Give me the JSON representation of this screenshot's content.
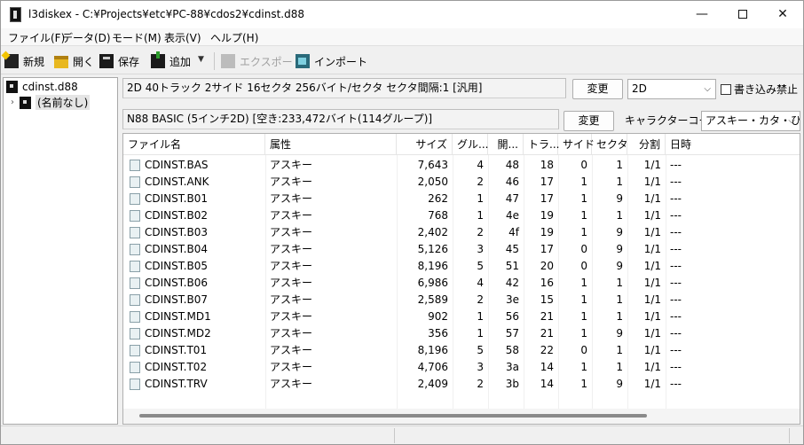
{
  "window": {
    "title": "l3diskex - C:¥Projects¥etc¥PC-88¥cdos2¥cdinst.d88",
    "minimize_glyph": "—",
    "close_glyph": "✕"
  },
  "menu": [
    "ファイル(F)",
    "データ(D)",
    "モード(M)",
    "表示(V)",
    "ヘルプ(H)"
  ],
  "toolbar": {
    "new": "新規",
    "open": "開く",
    "save": "保存",
    "add": "追加",
    "dropdown": "▼",
    "export": "エクスポート",
    "import": "インポート"
  },
  "tree": {
    "root": "cdinst.d88",
    "expander": "›",
    "child": "(名前なし)"
  },
  "disk_info": {
    "text": "2D  40トラック 2サイド 16セクタ 256バイト/セクタ セクタ間隔:1 [汎用]",
    "change_button": "変更",
    "disk_type": "2D",
    "write_protect_label": "書き込み禁止",
    "write_protect_checked": false
  },
  "file_info": {
    "text": "N88 BASIC (5インチ2D) [空き:233,472バイト(114グループ)]",
    "change_button": "変更",
    "charcode_label": "キャラクターコード",
    "charcode_value": "アスキー・カタ・ひら"
  },
  "columns": [
    "ファイル名",
    "属性",
    "サイズ",
    "グル...",
    "開...",
    "トラ...",
    "サイド",
    "セクタ",
    "分割",
    "日時"
  ],
  "files": [
    {
      "name": "CDINST.BAS",
      "attr": "アスキー",
      "size": "7,643",
      "groups": "4",
      "start": "48",
      "track": "18",
      "side": "0",
      "sector": "1",
      "split": "1/1",
      "date": "---"
    },
    {
      "name": "CDINST.ANK",
      "attr": "アスキー",
      "size": "2,050",
      "groups": "2",
      "start": "46",
      "track": "17",
      "side": "1",
      "sector": "1",
      "split": "1/1",
      "date": "---"
    },
    {
      "name": "CDINST.B01",
      "attr": "アスキー",
      "size": "262",
      "groups": "1",
      "start": "47",
      "track": "17",
      "side": "1",
      "sector": "9",
      "split": "1/1",
      "date": "---"
    },
    {
      "name": "CDINST.B02",
      "attr": "アスキー",
      "size": "768",
      "groups": "1",
      "start": "4e",
      "track": "19",
      "side": "1",
      "sector": "1",
      "split": "1/1",
      "date": "---"
    },
    {
      "name": "CDINST.B03",
      "attr": "アスキー",
      "size": "2,402",
      "groups": "2",
      "start": "4f",
      "track": "19",
      "side": "1",
      "sector": "9",
      "split": "1/1",
      "date": "---"
    },
    {
      "name": "CDINST.B04",
      "attr": "アスキー",
      "size": "5,126",
      "groups": "3",
      "start": "45",
      "track": "17",
      "side": "0",
      "sector": "9",
      "split": "1/1",
      "date": "---"
    },
    {
      "name": "CDINST.B05",
      "attr": "アスキー",
      "size": "8,196",
      "groups": "5",
      "start": "51",
      "track": "20",
      "side": "0",
      "sector": "9",
      "split": "1/1",
      "date": "---"
    },
    {
      "name": "CDINST.B06",
      "attr": "アスキー",
      "size": "6,986",
      "groups": "4",
      "start": "42",
      "track": "16",
      "side": "1",
      "sector": "1",
      "split": "1/1",
      "date": "---"
    },
    {
      "name": "CDINST.B07",
      "attr": "アスキー",
      "size": "2,589",
      "groups": "2",
      "start": "3e",
      "track": "15",
      "side": "1",
      "sector": "1",
      "split": "1/1",
      "date": "---"
    },
    {
      "name": "CDINST.MD1",
      "attr": "アスキー",
      "size": "902",
      "groups": "1",
      "start": "56",
      "track": "21",
      "side": "1",
      "sector": "1",
      "split": "1/1",
      "date": "---"
    },
    {
      "name": "CDINST.MD2",
      "attr": "アスキー",
      "size": "356",
      "groups": "1",
      "start": "57",
      "track": "21",
      "side": "1",
      "sector": "9",
      "split": "1/1",
      "date": "---"
    },
    {
      "name": "CDINST.T01",
      "attr": "アスキー",
      "size": "8,196",
      "groups": "5",
      "start": "58",
      "track": "22",
      "side": "0",
      "sector": "1",
      "split": "1/1",
      "date": "---"
    },
    {
      "name": "CDINST.T02",
      "attr": "アスキー",
      "size": "4,706",
      "groups": "3",
      "start": "3a",
      "track": "14",
      "side": "1",
      "sector": "1",
      "split": "1/1",
      "date": "---"
    },
    {
      "name": "CDINST.TRV",
      "attr": "アスキー",
      "size": "2,409",
      "groups": "2",
      "start": "3b",
      "track": "14",
      "side": "1",
      "sector": "9",
      "split": "1/1",
      "date": "---"
    }
  ]
}
